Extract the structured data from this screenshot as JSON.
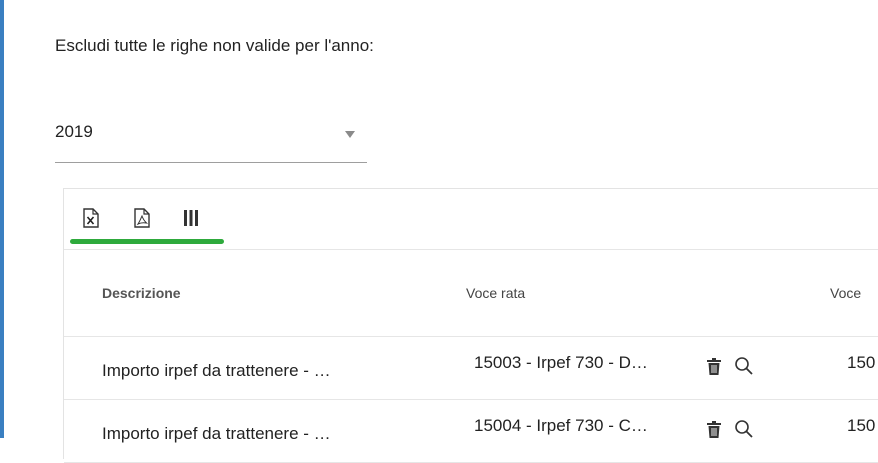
{
  "filter": {
    "label": "Escludi tutte le righe non valide per l'anno:",
    "year_value": "2019"
  },
  "toolbar": {
    "buttons": [
      {
        "name": "excel-export",
        "icon": "excel-file-icon"
      },
      {
        "name": "pdf-export",
        "icon": "pdf-file-icon"
      },
      {
        "name": "columns-chooser",
        "icon": "columns-icon"
      }
    ],
    "active_color": "#2eaa3c"
  },
  "table": {
    "columns": [
      "Descrizione",
      "Voce rata",
      "Voce"
    ],
    "rows": [
      {
        "descrizione": "Importo irpef da trattenere - …",
        "voce_rata": "15003 - Irpef 730 - D…",
        "voce": "150"
      },
      {
        "descrizione": "Importo irpef da trattenere - …",
        "voce_rata": "15004 - Irpef 730 - C…",
        "voce": "150"
      }
    ]
  }
}
